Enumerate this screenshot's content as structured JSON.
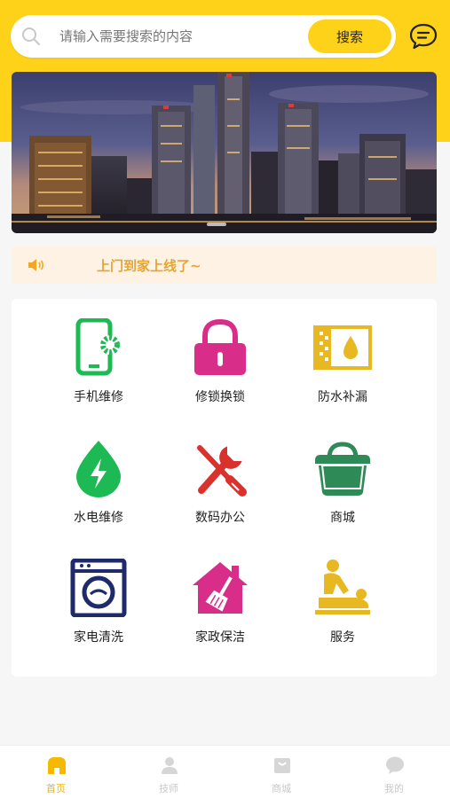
{
  "search": {
    "placeholder": "请输入需要搜索的内容",
    "button_label": "搜索"
  },
  "notice": {
    "text": "上门到家上线了~"
  },
  "services": [
    {
      "label": "手机维修",
      "icon": "phone-settings-icon",
      "color": "#1db954"
    },
    {
      "label": "修锁换锁",
      "icon": "padlock-icon",
      "color": "#d92d8a"
    },
    {
      "label": "防水补漏",
      "icon": "waterproof-icon",
      "color": "#e8b822"
    },
    {
      "label": "水电维修",
      "icon": "water-lightning-icon",
      "color": "#1db954"
    },
    {
      "label": "数码办公",
      "icon": "tools-icon",
      "color": "#d9322d"
    },
    {
      "label": "商城",
      "icon": "shopping-bag-icon",
      "color": "#2e8b57"
    },
    {
      "label": "家电清洗",
      "icon": "washing-machine-icon",
      "color": "#1f2a6b"
    },
    {
      "label": "家政保洁",
      "icon": "house-broom-icon",
      "color": "#d92d8a"
    },
    {
      "label": "服务",
      "icon": "massage-service-icon",
      "color": "#e8b822"
    }
  ],
  "tabs": [
    {
      "label": "首页",
      "icon": "home-icon",
      "active": true
    },
    {
      "label": "技师",
      "icon": "technician-icon",
      "active": false
    },
    {
      "label": "商城",
      "icon": "mall-icon",
      "active": false
    },
    {
      "label": "我的",
      "icon": "profile-icon",
      "active": false
    }
  ],
  "colors": {
    "brand_yellow": "#ffd21a",
    "notice_text": "#e7a432",
    "tab_active": "#f0b400",
    "tab_inactive": "#c8c8c8"
  }
}
